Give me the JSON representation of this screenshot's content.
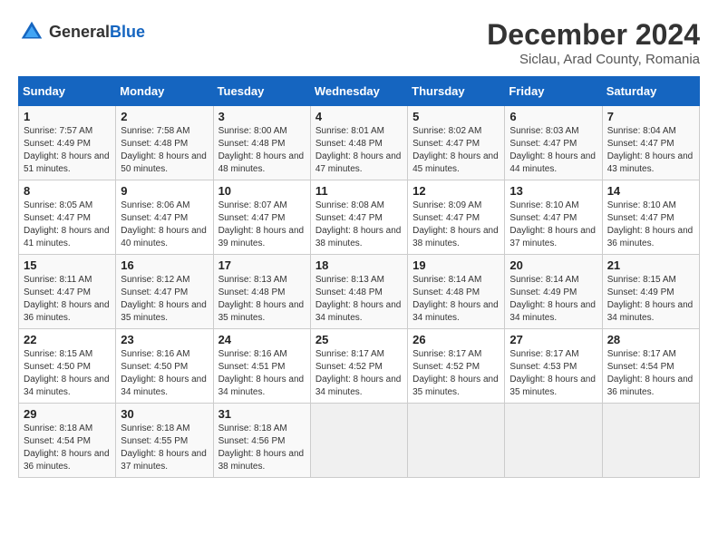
{
  "header": {
    "logo_general": "General",
    "logo_blue": "Blue",
    "title": "December 2024",
    "subtitle": "Siclau, Arad County, Romania"
  },
  "calendar": {
    "weekdays": [
      "Sunday",
      "Monday",
      "Tuesday",
      "Wednesday",
      "Thursday",
      "Friday",
      "Saturday"
    ],
    "weeks": [
      [
        {
          "day": "1",
          "info": "Sunrise: 7:57 AM\nSunset: 4:49 PM\nDaylight: 8 hours and 51 minutes."
        },
        {
          "day": "2",
          "info": "Sunrise: 7:58 AM\nSunset: 4:48 PM\nDaylight: 8 hours and 50 minutes."
        },
        {
          "day": "3",
          "info": "Sunrise: 8:00 AM\nSunset: 4:48 PM\nDaylight: 8 hours and 48 minutes."
        },
        {
          "day": "4",
          "info": "Sunrise: 8:01 AM\nSunset: 4:48 PM\nDaylight: 8 hours and 47 minutes."
        },
        {
          "day": "5",
          "info": "Sunrise: 8:02 AM\nSunset: 4:47 PM\nDaylight: 8 hours and 45 minutes."
        },
        {
          "day": "6",
          "info": "Sunrise: 8:03 AM\nSunset: 4:47 PM\nDaylight: 8 hours and 44 minutes."
        },
        {
          "day": "7",
          "info": "Sunrise: 8:04 AM\nSunset: 4:47 PM\nDaylight: 8 hours and 43 minutes."
        }
      ],
      [
        {
          "day": "8",
          "info": "Sunrise: 8:05 AM\nSunset: 4:47 PM\nDaylight: 8 hours and 41 minutes."
        },
        {
          "day": "9",
          "info": "Sunrise: 8:06 AM\nSunset: 4:47 PM\nDaylight: 8 hours and 40 minutes."
        },
        {
          "day": "10",
          "info": "Sunrise: 8:07 AM\nSunset: 4:47 PM\nDaylight: 8 hours and 39 minutes."
        },
        {
          "day": "11",
          "info": "Sunrise: 8:08 AM\nSunset: 4:47 PM\nDaylight: 8 hours and 38 minutes."
        },
        {
          "day": "12",
          "info": "Sunrise: 8:09 AM\nSunset: 4:47 PM\nDaylight: 8 hours and 38 minutes."
        },
        {
          "day": "13",
          "info": "Sunrise: 8:10 AM\nSunset: 4:47 PM\nDaylight: 8 hours and 37 minutes."
        },
        {
          "day": "14",
          "info": "Sunrise: 8:10 AM\nSunset: 4:47 PM\nDaylight: 8 hours and 36 minutes."
        }
      ],
      [
        {
          "day": "15",
          "info": "Sunrise: 8:11 AM\nSunset: 4:47 PM\nDaylight: 8 hours and 36 minutes."
        },
        {
          "day": "16",
          "info": "Sunrise: 8:12 AM\nSunset: 4:47 PM\nDaylight: 8 hours and 35 minutes."
        },
        {
          "day": "17",
          "info": "Sunrise: 8:13 AM\nSunset: 4:48 PM\nDaylight: 8 hours and 35 minutes."
        },
        {
          "day": "18",
          "info": "Sunrise: 8:13 AM\nSunset: 4:48 PM\nDaylight: 8 hours and 34 minutes."
        },
        {
          "day": "19",
          "info": "Sunrise: 8:14 AM\nSunset: 4:48 PM\nDaylight: 8 hours and 34 minutes."
        },
        {
          "day": "20",
          "info": "Sunrise: 8:14 AM\nSunset: 4:49 PM\nDaylight: 8 hours and 34 minutes."
        },
        {
          "day": "21",
          "info": "Sunrise: 8:15 AM\nSunset: 4:49 PM\nDaylight: 8 hours and 34 minutes."
        }
      ],
      [
        {
          "day": "22",
          "info": "Sunrise: 8:15 AM\nSunset: 4:50 PM\nDaylight: 8 hours and 34 minutes."
        },
        {
          "day": "23",
          "info": "Sunrise: 8:16 AM\nSunset: 4:50 PM\nDaylight: 8 hours and 34 minutes."
        },
        {
          "day": "24",
          "info": "Sunrise: 8:16 AM\nSunset: 4:51 PM\nDaylight: 8 hours and 34 minutes."
        },
        {
          "day": "25",
          "info": "Sunrise: 8:17 AM\nSunset: 4:52 PM\nDaylight: 8 hours and 34 minutes."
        },
        {
          "day": "26",
          "info": "Sunrise: 8:17 AM\nSunset: 4:52 PM\nDaylight: 8 hours and 35 minutes."
        },
        {
          "day": "27",
          "info": "Sunrise: 8:17 AM\nSunset: 4:53 PM\nDaylight: 8 hours and 35 minutes."
        },
        {
          "day": "28",
          "info": "Sunrise: 8:17 AM\nSunset: 4:54 PM\nDaylight: 8 hours and 36 minutes."
        }
      ],
      [
        {
          "day": "29",
          "info": "Sunrise: 8:18 AM\nSunset: 4:54 PM\nDaylight: 8 hours and 36 minutes."
        },
        {
          "day": "30",
          "info": "Sunrise: 8:18 AM\nSunset: 4:55 PM\nDaylight: 8 hours and 37 minutes."
        },
        {
          "day": "31",
          "info": "Sunrise: 8:18 AM\nSunset: 4:56 PM\nDaylight: 8 hours and 38 minutes."
        },
        {
          "day": "",
          "info": ""
        },
        {
          "day": "",
          "info": ""
        },
        {
          "day": "",
          "info": ""
        },
        {
          "day": "",
          "info": ""
        }
      ]
    ]
  }
}
